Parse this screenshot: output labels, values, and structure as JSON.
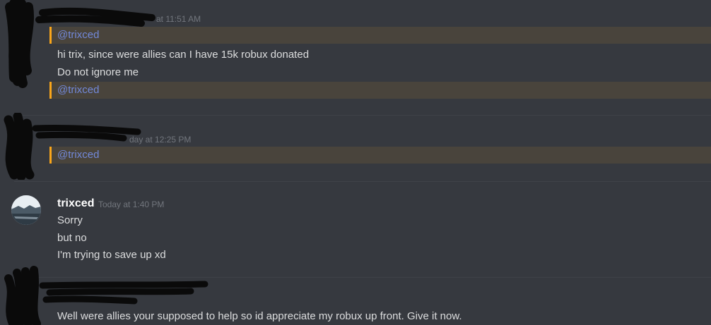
{
  "colors": {
    "background": "#36393f",
    "mention_bg": "#49443c",
    "mention_bar": "#faa61a",
    "mention_text": "#7289da",
    "message_text": "#dcddde",
    "timestamp": "#72767d"
  },
  "messages": [
    {
      "timestamp": "at 11:51 AM",
      "mention1": "@trixced",
      "line1": "hi trix, since were allies can I have 15k robux donated",
      "line2": "Do not ignore me",
      "mention2": "@trixced"
    },
    {
      "timestamp": "day at 12:25 PM",
      "mention": "@trixced"
    },
    {
      "username": "trixced",
      "timestamp": "Today at 1:40 PM",
      "avatar_icon": "landscape-avatar-icon",
      "lines": [
        "Sorry",
        "but no",
        "I'm trying to save up xd"
      ]
    },
    {
      "line": "Well were allies your supposed to help so id appreciate my robux up front. Give it now."
    }
  ]
}
